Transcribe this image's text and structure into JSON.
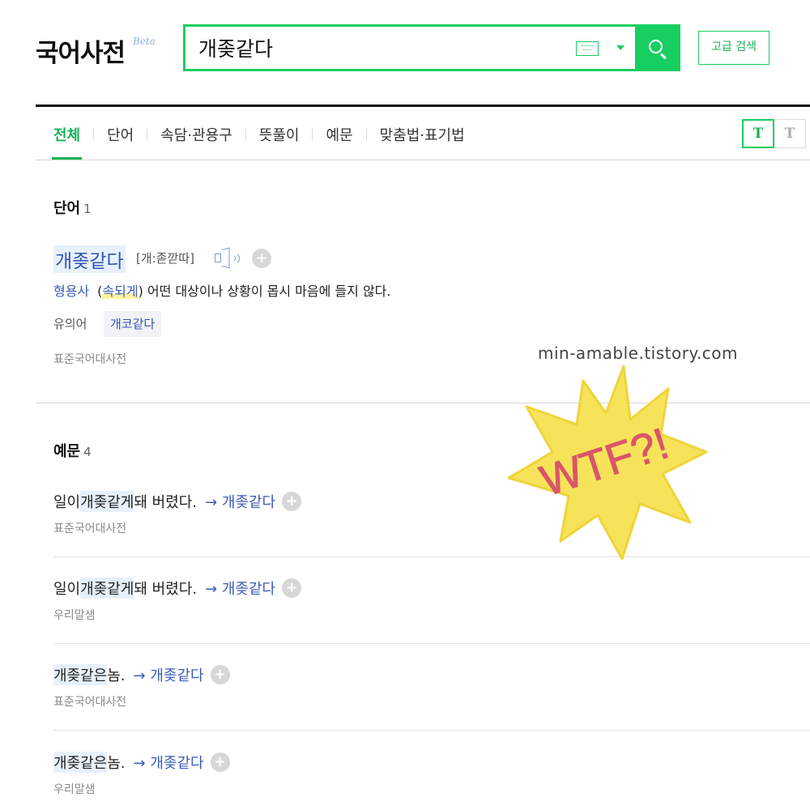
{
  "header": {
    "logo": "국어사전",
    "beta": "Beta",
    "search_value": "개좆같다",
    "keyboard_icon": "keyboard-icon",
    "search_icon": "search-icon",
    "advanced_label": "고급 검색",
    "accent_color": "#19ce60"
  },
  "tabs": {
    "items": [
      "전체",
      "단어",
      "속담·관용구",
      "뜻풀이",
      "예문",
      "맞춤법·표기법"
    ],
    "active": "전체"
  },
  "font_size_buttons": [
    "T",
    "T"
  ],
  "word_section": {
    "title": "단어",
    "count": "1",
    "entry": {
      "headword": "개좆같다",
      "pronunciation": "[개:졷깓따]",
      "pos": "형용사",
      "paren_open": "(",
      "link": "속되게",
      "definition": ") 어떤 대상이나 상황이 몹시 마음에 들지 않다.",
      "synonym_label": "유의어",
      "synonym": "개코같다",
      "source": "표준국어대사전"
    }
  },
  "example_section": {
    "title": "예문",
    "count": "4",
    "items": [
      {
        "pre": "일이 ",
        "highlight": "개좆같게",
        "post": " 돼 버렸다.",
        "link": "→ 개좆같다",
        "source": "표준국어대사전"
      },
      {
        "pre": "일이 ",
        "highlight": "개좆같게",
        "post": " 돼 버렸다.",
        "link": "→ 개좆같다",
        "source": "우리말샘"
      },
      {
        "pre": "",
        "highlight": "개좆같은",
        "post": " 놈.",
        "link": "→ 개좆같다",
        "source": "표준국어대사전"
      },
      {
        "pre": "",
        "highlight": "개좆같은",
        "post": " 놈.",
        "link": "→ 개좆같다",
        "source": "우리말샘"
      }
    ]
  },
  "overlay": {
    "watermark": "min-amable.tistory.com",
    "sticker_text": "WTF?!",
    "sticker_color": "#f7e35a",
    "sticker_text_color": "#d9566a"
  }
}
